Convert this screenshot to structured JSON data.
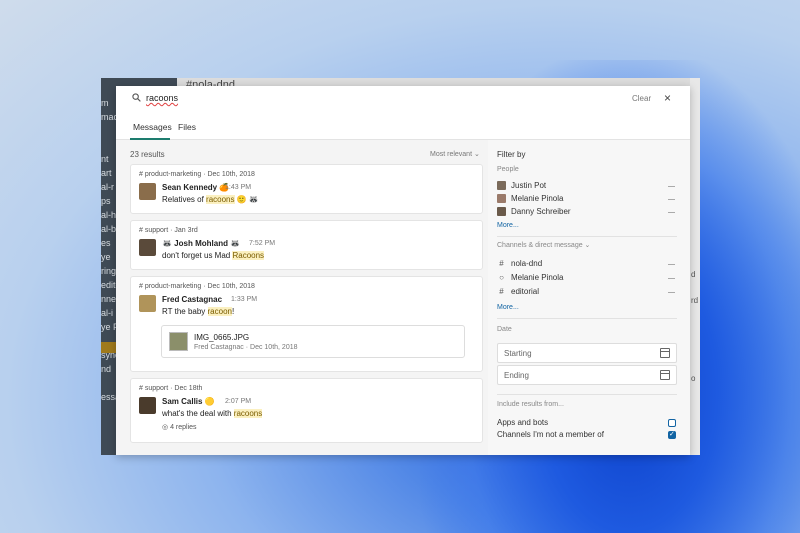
{
  "app": {
    "channel_header": "#nola-dnd",
    "sidebar_lines": [
      "",
      "m",
      "mac",
      "",
      "",
      "nt",
      "art",
      "al-r",
      "ps",
      "al-h",
      "al-b",
      "es",
      "ye",
      "ring",
      "edito",
      "nne",
      "al-i",
      "ye Pl",
      "",
      "sync",
      "nd",
      "",
      "essa"
    ],
    "right_strip": [
      "d",
      "rd",
      "o"
    ]
  },
  "search": {
    "query": "racoons",
    "clear_label": "Clear",
    "close_label": "×"
  },
  "tabs": [
    {
      "label": "Messages",
      "active": true
    },
    {
      "label": "Files",
      "active": false
    }
  ],
  "results": {
    "count": "23 results",
    "sort_label": "Most relevant ⌄",
    "items": [
      {
        "channel": "# product-marketing · Dec 10th, 2018",
        "author": "Sean Kennedy 🍊",
        "time": "1:43 PM",
        "msg_before": "Relatives of ",
        "highlight": "racoons",
        "msg_after": " 🙂 🦝",
        "avatar_color": "#8a6d4b"
      },
      {
        "channel": "# support · Jan 3rd",
        "author": "🦝 Josh Mohland 🦝",
        "time": "7:52 PM",
        "msg_before": "don't forget us Mad ",
        "highlight": "Racoons",
        "msg_after": "",
        "avatar_color": "#5a4a3a"
      },
      {
        "channel": "# product-marketing · Dec 10th, 2018",
        "author": "Fred Castagnac",
        "time": "1:33 PM",
        "msg_before": "RT the baby ",
        "highlight": "racoon",
        "msg_after": "!",
        "avatar_color": "#b0945a",
        "attachment": {
          "name": "IMG_0665.JPG",
          "meta": "Fred Castagnac · Dec 10th, 2018"
        }
      },
      {
        "channel": "# support · Dec 18th",
        "author": "Sam Callis 🟡",
        "time": "2:07 PM",
        "msg_before": "what's the deal with ",
        "highlight": "racoons",
        "msg_after": "",
        "avatar_color": "#4a3b2c",
        "replies": "4 replies"
      }
    ]
  },
  "filters": {
    "title": "Filter by",
    "people_label": "People",
    "people": [
      {
        "name": "Justin Pot",
        "color": "#7a6a5a"
      },
      {
        "name": "Melanie Pinola",
        "color": "#9a7a6a"
      },
      {
        "name": "Danny Schreiber",
        "color": "#6a5a4a"
      }
    ],
    "people_more": "More...",
    "channels_label": "Channels & direct message ⌄",
    "channels": [
      {
        "symbol": "#",
        "name": "nola-dnd"
      },
      {
        "symbol": "○",
        "name": "Melanie Pinola"
      },
      {
        "symbol": "#",
        "name": "editorial"
      }
    ],
    "channels_more": "More...",
    "date_label": "Date",
    "date_start": "Starting",
    "date_end": "Ending",
    "include_label": "Include results from...",
    "include": [
      {
        "label": "Apps and bots",
        "checked": false
      },
      {
        "label": "Channels I'm not a member of",
        "checked": true
      }
    ]
  }
}
